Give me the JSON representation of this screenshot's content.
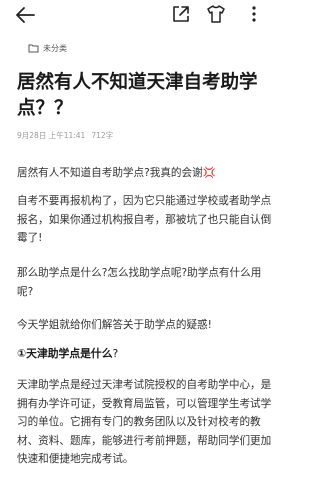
{
  "header": {
    "back_icon": "back-arrow-icon",
    "share_icon": "share-icon",
    "shirt_icon": "shirt-icon",
    "more_icon": "more-vertical-icon"
  },
  "category": {
    "icon": "folder-icon",
    "label": "未分类"
  },
  "article": {
    "title": "居然有人不知道天津自考助学点？？",
    "date": "9月28日 上午11:41",
    "word_count": "712字",
    "paragraphs": [
      "居然有人不知道自考助学点?我真的会谢💢",
      "自考不要再报机构了，因为它只能通过学校或者助学点报名，如果你通过机构报自考，那被坑了也只能自认倒霉了!",
      "那么助学点是什么?怎么找助学点呢?助学点有什么用呢?",
      "今天学姐就给你们解答关于助学点的疑惑!"
    ],
    "section_heading": "①天津助学点是什么",
    "section_heading_suffix": "?",
    "section_paragraph": "天津助学点是经过天津考试院授权的自考助学中心，是拥有办学许可证，受教育局监管，可以管理学生考试学习的单位。它拥有专门的教务团队以及针对校考的教材、资料、题库，能够进行考前押题，帮助同学们更加快速和便捷地完成考试。"
  }
}
